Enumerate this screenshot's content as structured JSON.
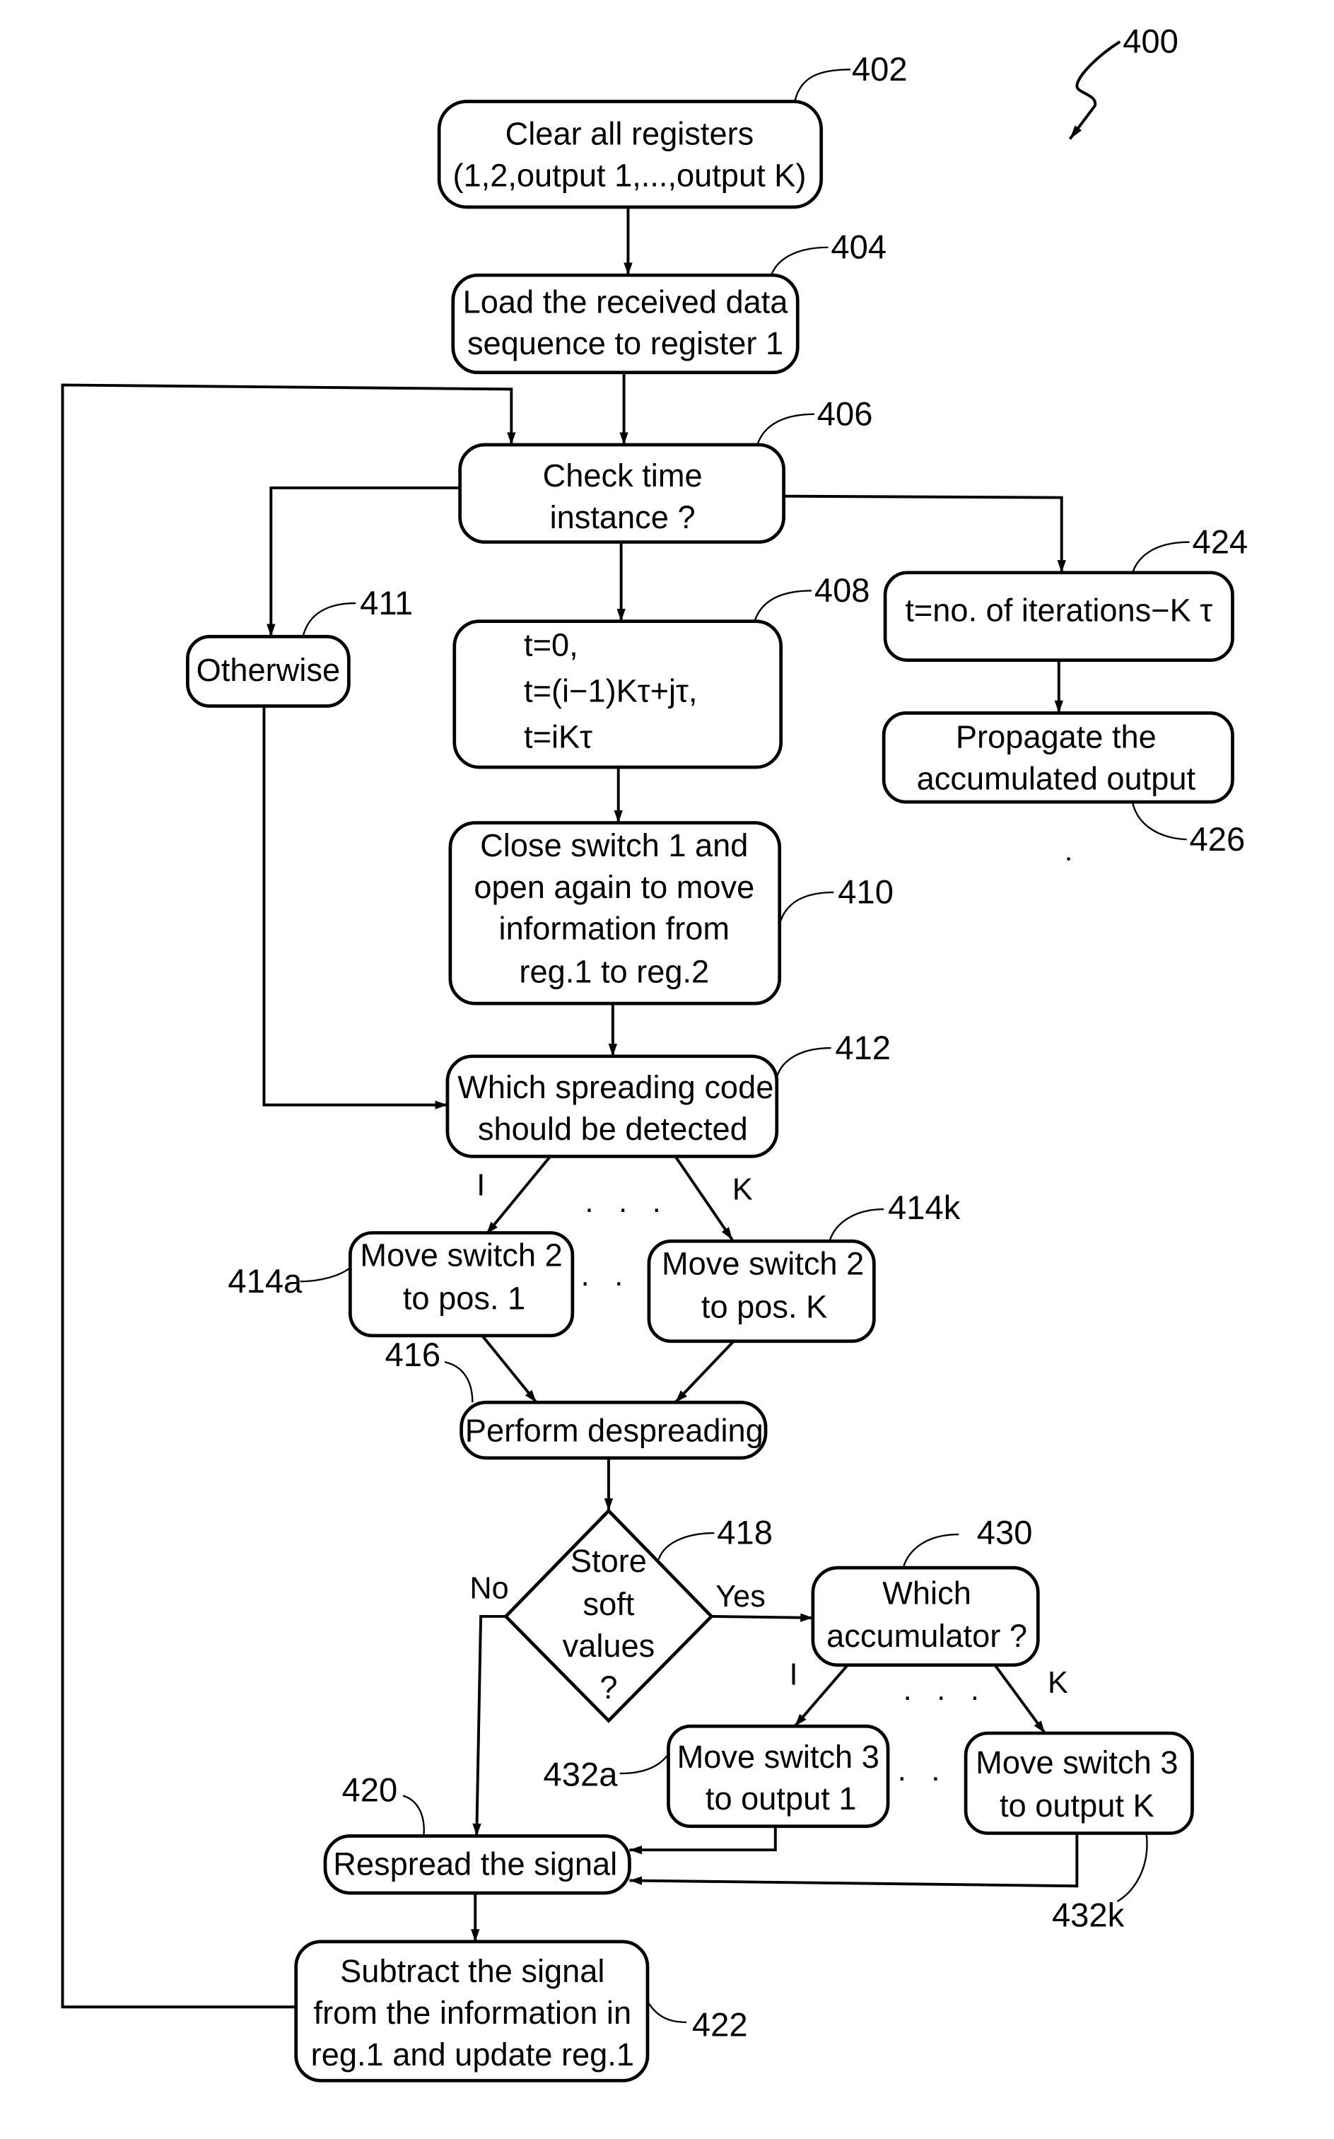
{
  "figure": {
    "ref": "400",
    "nodes": {
      "n402": {
        "ref": "402",
        "lines": [
          "Clear all registers",
          "(1,2,output 1,...,output K)"
        ]
      },
      "n404": {
        "ref": "404",
        "lines": [
          "Load the received data",
          "sequence to register 1"
        ]
      },
      "n406": {
        "ref": "406",
        "lines": [
          "Check time",
          "instance ?"
        ]
      },
      "n408": {
        "ref": "408",
        "lines": [
          "t=0,",
          "t=(i−1)Kτ+jτ,",
          "t=iKτ"
        ]
      },
      "n410": {
        "ref": "410",
        "lines": [
          "Close switch 1 and",
          "open again to move",
          "information from",
          "reg.1 to reg.2"
        ]
      },
      "n411": {
        "ref": "411",
        "lines": [
          "Otherwise"
        ]
      },
      "n412": {
        "ref": "412",
        "lines": [
          "Which spreading code",
          "should be detected"
        ]
      },
      "n414a": {
        "ref": "414a",
        "lines": [
          "Move switch 2",
          "to pos. 1"
        ]
      },
      "n414k": {
        "ref": "414k",
        "lines": [
          "Move switch 2",
          "to pos. K"
        ]
      },
      "n416": {
        "ref": "416",
        "lines": [
          "Perform despreading"
        ]
      },
      "n418": {
        "ref": "418",
        "lines": [
          "Store",
          "soft",
          "values",
          "?"
        ]
      },
      "n420": {
        "ref": "420",
        "lines": [
          "Respread the signal"
        ]
      },
      "n422": {
        "ref": "422",
        "lines": [
          "Subtract the signal",
          "from the information in",
          "reg.1 and update reg.1"
        ]
      },
      "n424": {
        "ref": "424",
        "lines": [
          "t=no. of iterations−K τ"
        ]
      },
      "n426": {
        "ref": "426",
        "lines": [
          "Propagate the",
          "accumulated output"
        ]
      },
      "n430": {
        "ref": "430",
        "lines": [
          "Which",
          "accumulator ?"
        ]
      },
      "n432a": {
        "ref": "432a",
        "lines": [
          "Move switch 3",
          "to output 1"
        ]
      },
      "n432k": {
        "ref": "432k",
        "lines": [
          "Move switch 3",
          "to output K"
        ]
      }
    },
    "edge_labels": {
      "code_1": "I",
      "code_k": "K",
      "acc_1": "I",
      "acc_k": "K",
      "no": "No",
      "yes": "Yes",
      "ellipsis": ". . ."
    }
  }
}
